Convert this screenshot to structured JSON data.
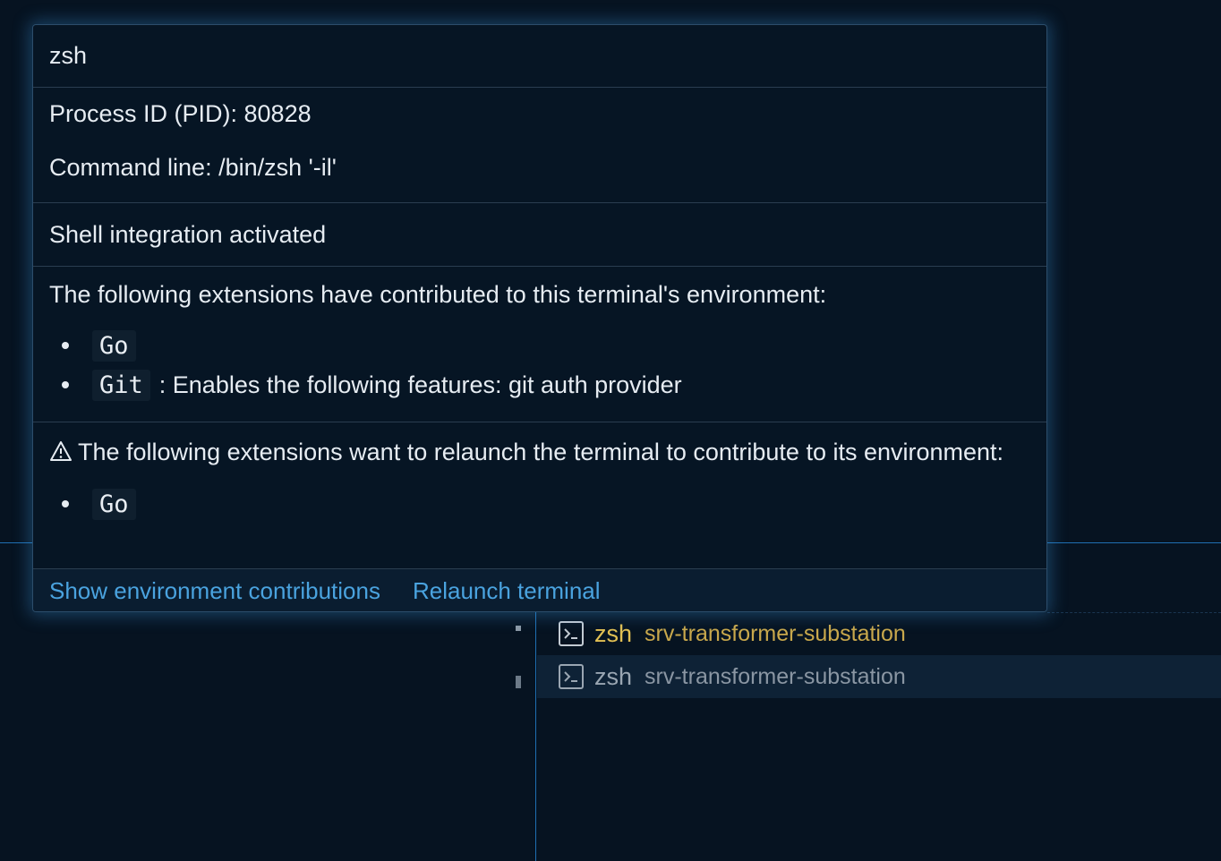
{
  "hover": {
    "title": "zsh",
    "process_id": "Process ID (PID): 80828",
    "command_line": "Command line: /bin/zsh '-il'",
    "shell_integration": "Shell integration activated",
    "contrib_intro": "The following extensions have contributed to this terminal's environment:",
    "contributed_extensions": [
      {
        "name": "Go",
        "detail": ""
      },
      {
        "name": "Git",
        "detail": ": Enables the following features: git auth provider"
      }
    ],
    "relaunch_text": "The following extensions want to relaunch the terminal to contribute to its environment:",
    "relaunch_extensions": [
      "Go"
    ],
    "actions": {
      "show_contributions": "Show environment contributions",
      "relaunch": "Relaunch terminal"
    }
  },
  "terminals": [
    {
      "name": "zsh",
      "description": "srv-transformer-substation",
      "selected": false
    },
    {
      "name": "zsh",
      "description": "srv-transformer-substation",
      "selected": true
    }
  ],
  "icons": {
    "warning": "warning-triangle-icon",
    "terminal": "terminal-icon"
  },
  "colors": {
    "background": "#061321",
    "link": "#4aa3df",
    "terminal_name": "#e2c053",
    "focus_border": "#1f6fb2"
  }
}
